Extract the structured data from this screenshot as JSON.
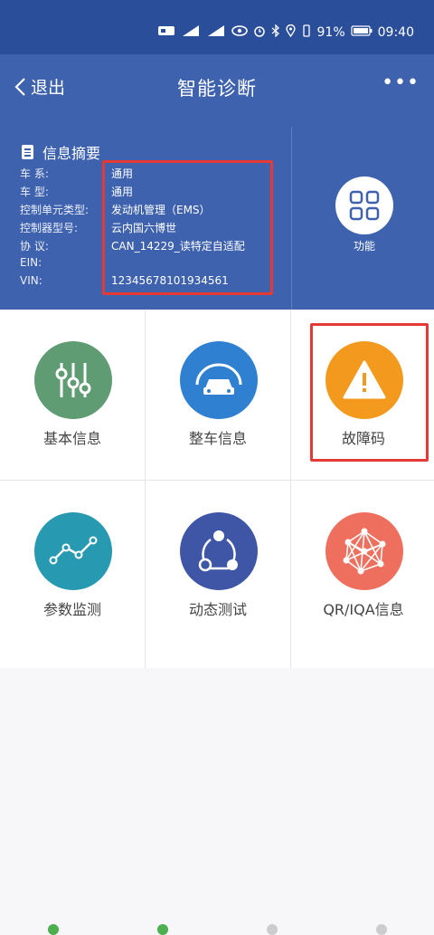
{
  "status_bar": {
    "battery_percent": "91%",
    "time": "09:40",
    "icons": [
      "nfc-icon",
      "signal-icon",
      "signal-icon",
      "eye-icon",
      "alarm-icon",
      "bluetooth-icon",
      "location-icon",
      "vibrate-icon",
      "battery-icon"
    ]
  },
  "header": {
    "back_label": "退出",
    "title": "智能诊断",
    "more_label": "•••"
  },
  "info": {
    "heading": "信息摘要",
    "rows": [
      {
        "key": "车 系:",
        "value": "通用"
      },
      {
        "key": "车 型:",
        "value": "通用"
      },
      {
        "key": "控制单元类型:",
        "value": "发动机管理（EMS）"
      },
      {
        "key": "控制器型号:",
        "value": "云内国六博世"
      },
      {
        "key": "协 议:",
        "value": "CAN_14229_读特定自适配"
      },
      {
        "key": "EIN:",
        "value": ""
      },
      {
        "key": "VIN:",
        "value": "12345678101934561"
      }
    ]
  },
  "function_button": {
    "label": "功能"
  },
  "grid": [
    {
      "label": "基本信息",
      "color": "#5f9b73",
      "icon": "sliders-icon"
    },
    {
      "label": "整车信息",
      "color": "#2f80d0",
      "icon": "car-icon"
    },
    {
      "label": "故障码",
      "color": "#f39a1e",
      "icon": "warning-icon"
    },
    {
      "label": "参数监测",
      "color": "#2799b1",
      "icon": "line-chart-icon"
    },
    {
      "label": "动态测试",
      "color": "#3f56a7",
      "icon": "share-icon"
    },
    {
      "label": "QR/IQA信息",
      "color": "#ee6f5d",
      "icon": "network-icon"
    }
  ],
  "colors": {
    "header": "#3e62ae",
    "status": "#2b4e9a",
    "highlight": "#e53935"
  }
}
